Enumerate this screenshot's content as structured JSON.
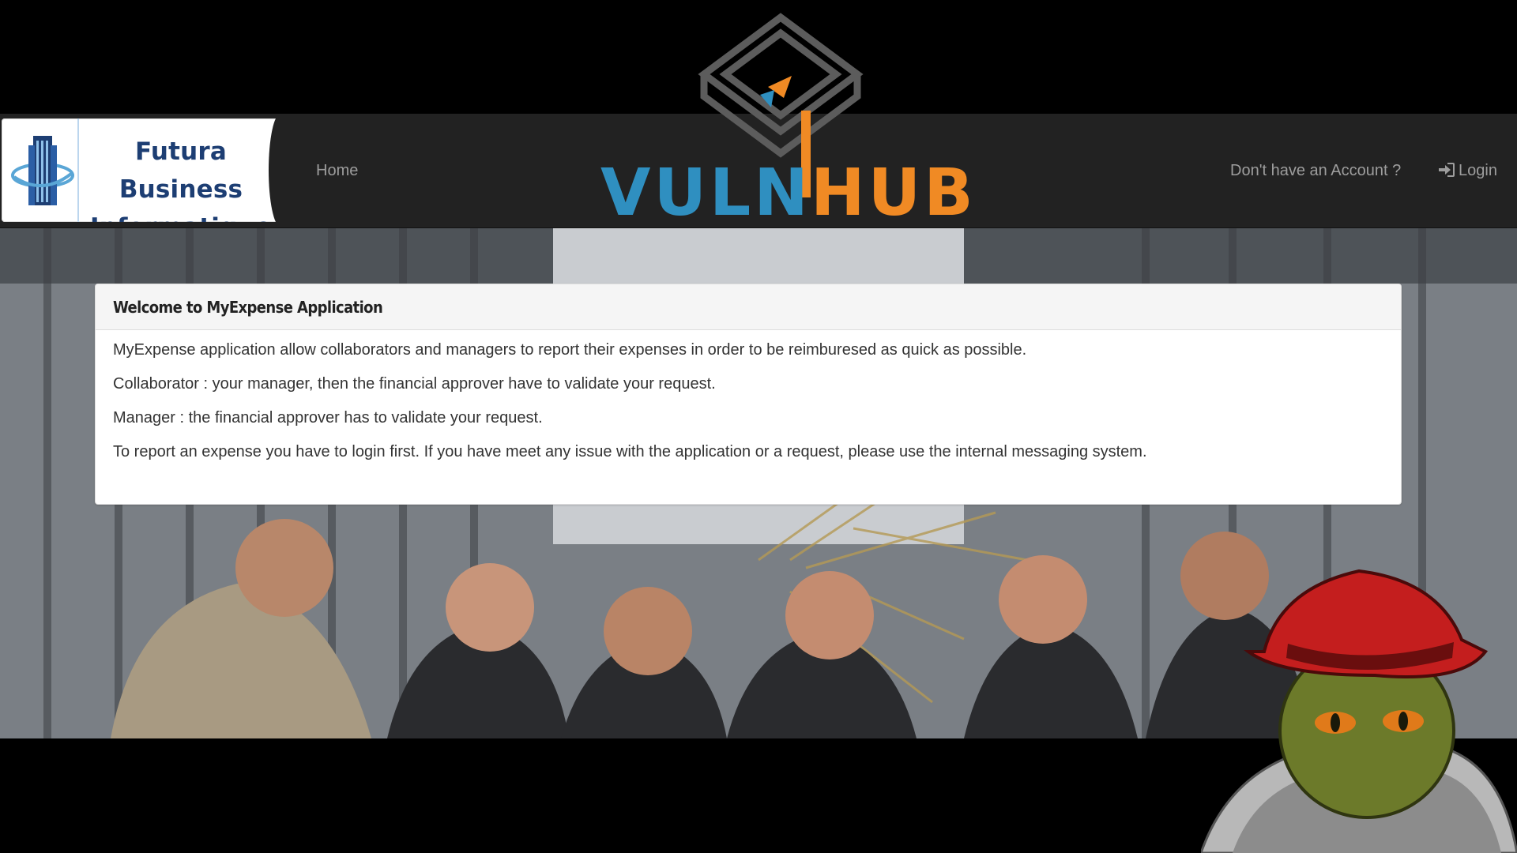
{
  "brand": {
    "line1": "Futura Business",
    "line2": "Informatique",
    "icon": "building-tower-icon"
  },
  "nav": {
    "home": "Home",
    "register": "Don't have an Account ?",
    "login": "Login",
    "login_icon": "sign-in-icon"
  },
  "panel": {
    "title": "Welcome to MyExpense Application",
    "paragraphs": [
      "MyExpense application allow collaborators and managers to report their expenses in order to be reimburesed as quick as possible.",
      "Collaborator : your manager, then the financial approver have to validate your request.",
      "Manager : the financial approver has to validate your request.",
      "To report an expense you have to login first. If you have meet any issue with the application or a request, please use the internal messaging system."
    ]
  },
  "watermark": {
    "text_left": "VULN",
    "text_right": "HUB",
    "color_left": "#2f8fc0",
    "color_right": "#f08a24"
  },
  "colors": {
    "navbar": "#222222",
    "nav_text": "#9d9d9d",
    "panel_heading_bg": "#f5f5f5"
  }
}
